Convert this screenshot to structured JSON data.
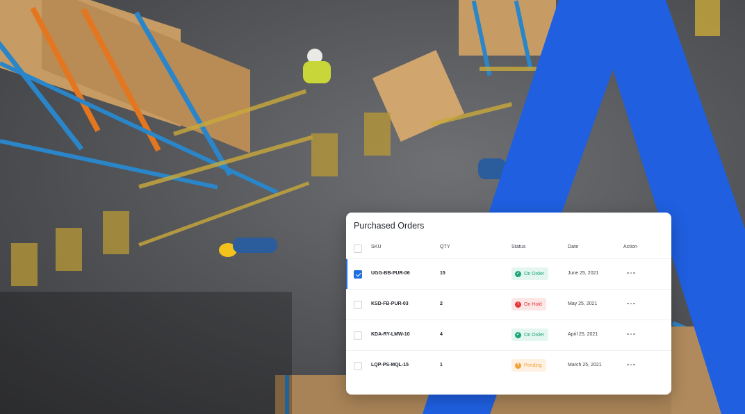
{
  "card": {
    "title": "Purchased Orders",
    "columns": {
      "sku": "SKU",
      "qty": "QTY",
      "status": "Status",
      "date": "Date",
      "action": "Action"
    },
    "rows": [
      {
        "sku": "UGG-BB-PUR-06",
        "qty": "15",
        "status": "On Order",
        "status_type": "success",
        "status_icon": "check-circle-icon",
        "date": "June 25, 2021",
        "selected": true
      },
      {
        "sku": "KSD-FB-PUR-03",
        "qty": "2",
        "status": "On Hold",
        "status_type": "danger",
        "status_icon": "alert-circle-icon",
        "date": "May 25, 2021",
        "selected": false
      },
      {
        "sku": "KDA-RY-LMW-10",
        "qty": "4",
        "status": "On Order",
        "status_type": "success",
        "status_icon": "check-circle-icon",
        "date": "April 25, 2021",
        "selected": false
      },
      {
        "sku": "LQP-PS-MQL-15",
        "qty": "1",
        "status": "Pending",
        "status_type": "warning",
        "status_icon": "help-circle-icon",
        "date": "March 25, 2021",
        "selected": false
      }
    ]
  },
  "colors": {
    "brand_blue": "#1f5fe0",
    "success_bg": "#e3f6ef",
    "success_fg": "#1aa57a",
    "danger_bg": "#fde6e6",
    "danger_fg": "#e5343c",
    "warning_bg": "#fff1e1",
    "warning_fg": "#f2a33a"
  }
}
